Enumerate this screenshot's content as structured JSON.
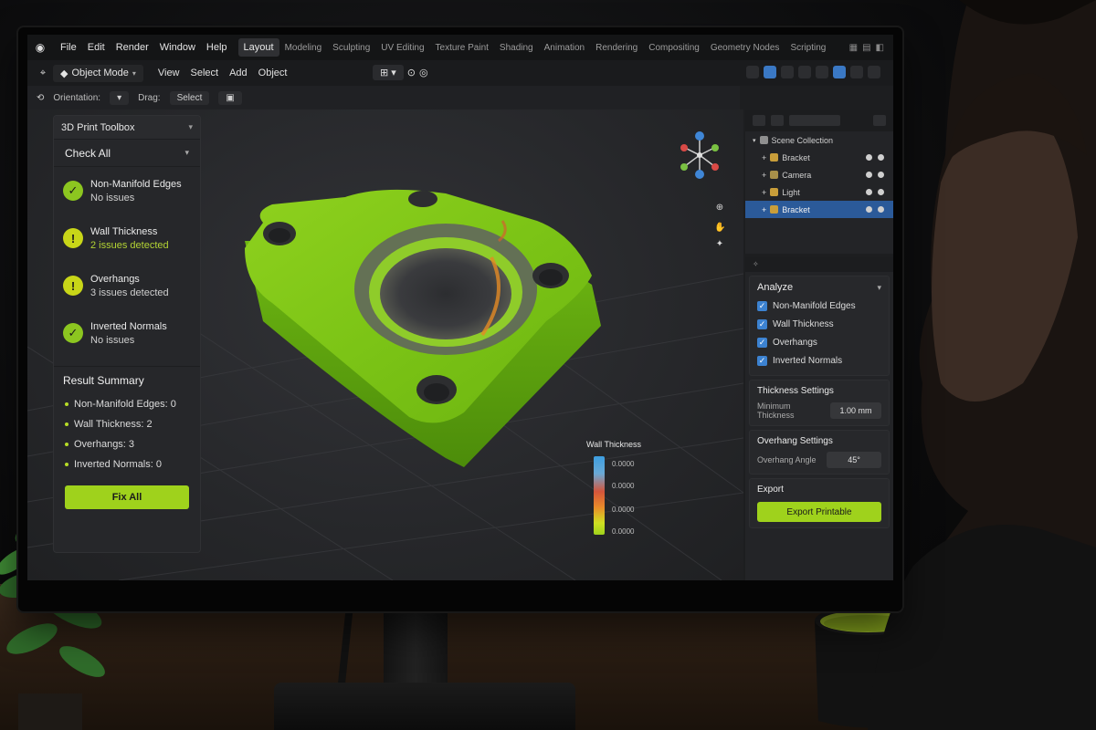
{
  "menubar": {
    "menus": [
      "File",
      "Edit",
      "Render",
      "Window",
      "Help"
    ],
    "workspaces": [
      "Layout",
      "Modeling",
      "Sculpting",
      "UV Editing",
      "Texture Paint",
      "Shading",
      "Animation",
      "Rendering",
      "Compositing",
      "Geometry Nodes",
      "Scripting"
    ],
    "active_workspace": "Layout"
  },
  "header": {
    "mode": "Object Mode",
    "menus": [
      "View",
      "Select",
      "Add",
      "Object"
    ]
  },
  "toolbar": {
    "orientation_label": "Orientation:",
    "drag_label": "Drag:",
    "select_label": "Select"
  },
  "left_panel": {
    "title": "3D Print Toolbox",
    "check_all": "Check All",
    "issues": [
      {
        "name": "Non-Manifold Edges",
        "status": "No issues",
        "state": "ok"
      },
      {
        "name": "Wall Thickness",
        "status": "2 issues detected",
        "state": "warn"
      },
      {
        "name": "Overhangs",
        "status": "3 issues detected",
        "state": "warn"
      },
      {
        "name": "Inverted Normals",
        "status": "No issues",
        "state": "ok"
      }
    ],
    "summary_title": "Result Summary",
    "summary": [
      "Non-Manifold Edges: 0",
      "Wall Thickness: 2",
      "Overhangs: 3",
      "Inverted Normals: 0"
    ],
    "fix_all": "Fix All"
  },
  "legend": {
    "title": "Wall Thickness",
    "values": [
      "0.0000",
      "0.0000",
      "0.0000",
      "0.0000"
    ]
  },
  "outliner": {
    "collection": "Scene Collection",
    "items": [
      {
        "label": "Bracket",
        "icon": "mesh-icon",
        "selected": false
      },
      {
        "label": "Camera",
        "icon": "camera-icon",
        "selected": false
      },
      {
        "label": "Light",
        "icon": "light-icon",
        "selected": false
      },
      {
        "label": "Bracket",
        "icon": "mesh-icon",
        "selected": true
      }
    ]
  },
  "properties": {
    "analyze_title": "Analyze",
    "analyze_items": [
      "Non-Manifold Edges",
      "Wall Thickness",
      "Overhangs",
      "Inverted Normals"
    ],
    "thickness_title": "Thickness Settings",
    "min_thickness_label": "Minimum Thickness",
    "min_thickness_value": "1.00 mm",
    "overhang_title": "Overhang Settings",
    "overhang_angle_label": "Overhang Angle",
    "overhang_angle_value": "45°",
    "export_title": "Export",
    "export_button": "Export Printable"
  },
  "colors": {
    "accent_green": "#9fd21c",
    "select_blue": "#2b5a99",
    "checkbox_blue": "#3c82d1",
    "warn_yellow": "#c8d618"
  }
}
